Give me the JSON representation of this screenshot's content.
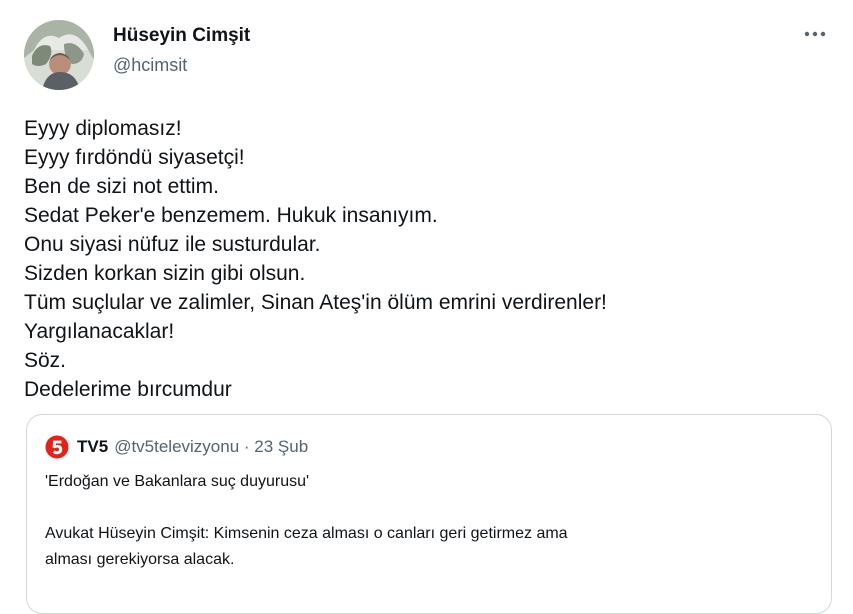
{
  "author": {
    "name": "Hüseyin Cimşit",
    "handle": "@hcimsit"
  },
  "more_icon": "more-horizontal-icon",
  "tweet": {
    "lines": [
      "Eyyy diplomasız!",
      "Eyyy fırdöndü siyasetçi!",
      "Ben de sizi not ettim.",
      "Sedat Peker'e benzemem. Hukuk insanıyım.",
      "Onu siyasi nüfuz ile susturdular.",
      "Sizden korkan sizin gibi olsun.",
      "Tüm suçlular ve zalimler, Sinan Ateş'in ölüm emrini verdirenler!",
      "Yargılanacaklar!",
      "Söz.",
      "Dedelerime bırcumdur"
    ]
  },
  "quote": {
    "logo_icon": "tv5-logo-icon",
    "logo_color": "#e2231a",
    "name": "TV5",
    "meta": "@tv5televizyonu · 23 Şub",
    "paragraphs": [
      "'Erdoğan ve Bakanlara suç duyurusu'",
      "Avukat Hüseyin Cimşit: Kimsenin ceza alması o canları geri getirmez ama",
      "alması gerekiyorsa alacak."
    ]
  },
  "colors": {
    "text": "#0f1419",
    "secondary": "#536471",
    "border": "#cfd9de"
  }
}
